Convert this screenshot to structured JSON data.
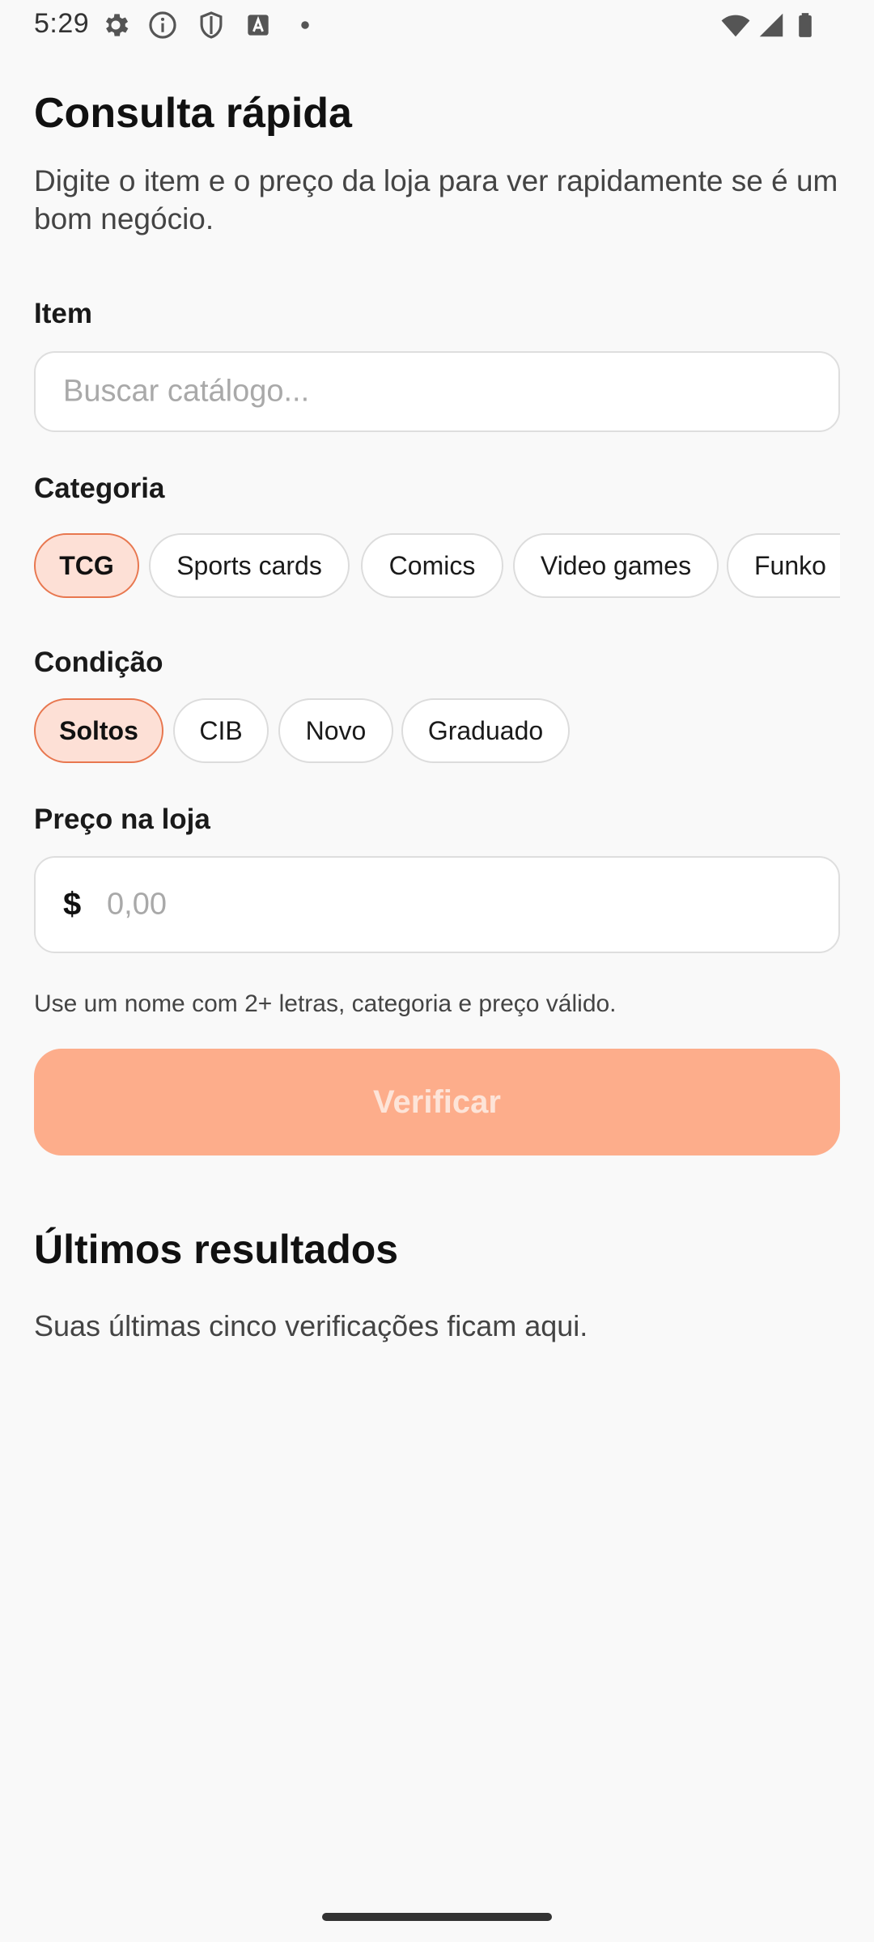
{
  "status_bar": {
    "time": "5:29",
    "icons_left": [
      "gear-icon",
      "info-icon",
      "shield-icon",
      "text-a-icon",
      "dot-icon"
    ],
    "icons_right": [
      "wifi-icon",
      "signal-icon",
      "battery-icon"
    ]
  },
  "header": {
    "title": "Consulta rápida",
    "subtitle": "Digite o item e o preço da loja para ver rapidamente se é um bom negócio."
  },
  "item_field": {
    "label": "Item",
    "value": "",
    "placeholder": "Buscar catálogo..."
  },
  "category": {
    "label": "Categoria",
    "selected": "TCG",
    "options": [
      "TCG",
      "Sports cards",
      "Comics",
      "Video games",
      "Funko"
    ]
  },
  "condition": {
    "label": "Condição",
    "selected": "Soltos",
    "options": [
      "Soltos",
      "CIB",
      "Novo",
      "Graduado"
    ]
  },
  "price_field": {
    "label": "Preço na loja",
    "currency": "$",
    "value": "",
    "placeholder": "0,00"
  },
  "hint": "Use um nome com 2+ letras, categoria e preço válido.",
  "verify_button": {
    "label": "Verificar",
    "enabled": false
  },
  "results": {
    "title": "Últimos resultados",
    "empty_text": "Suas últimas cinco verificações ficam aqui."
  },
  "colors": {
    "accent": "#e8774f",
    "chip_selected_bg": "#fde0d6",
    "button_disabled_bg": "#fdad8b",
    "button_disabled_text": "#fde4d8",
    "background": "#f9f9f9"
  }
}
